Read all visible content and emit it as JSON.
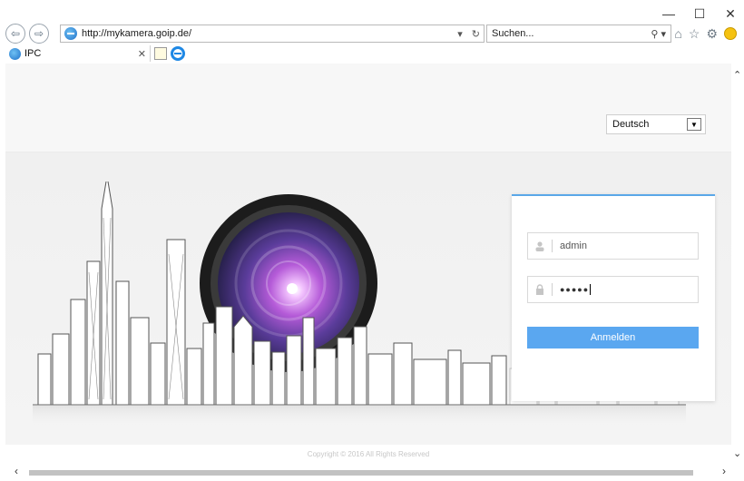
{
  "browser": {
    "url": "http://mykamera.goip.de/",
    "search_placeholder": "Suchen...",
    "tab_title": "IPC",
    "window_controls": [
      "minimize-icon",
      "maximize-icon",
      "close-icon"
    ],
    "toolbar_icons": [
      "home-icon",
      "favorites-star-icon",
      "settings-gear-icon",
      "feedback-smiley-icon"
    ]
  },
  "page": {
    "language_selected": "Deutsch",
    "login": {
      "username_value": "admin",
      "password_masked": "●●●●●",
      "submit_label": "Anmelden",
      "accent_color": "#5aa7f0"
    },
    "footer_text": "Copyright © 2016 All Rights Reserved"
  }
}
